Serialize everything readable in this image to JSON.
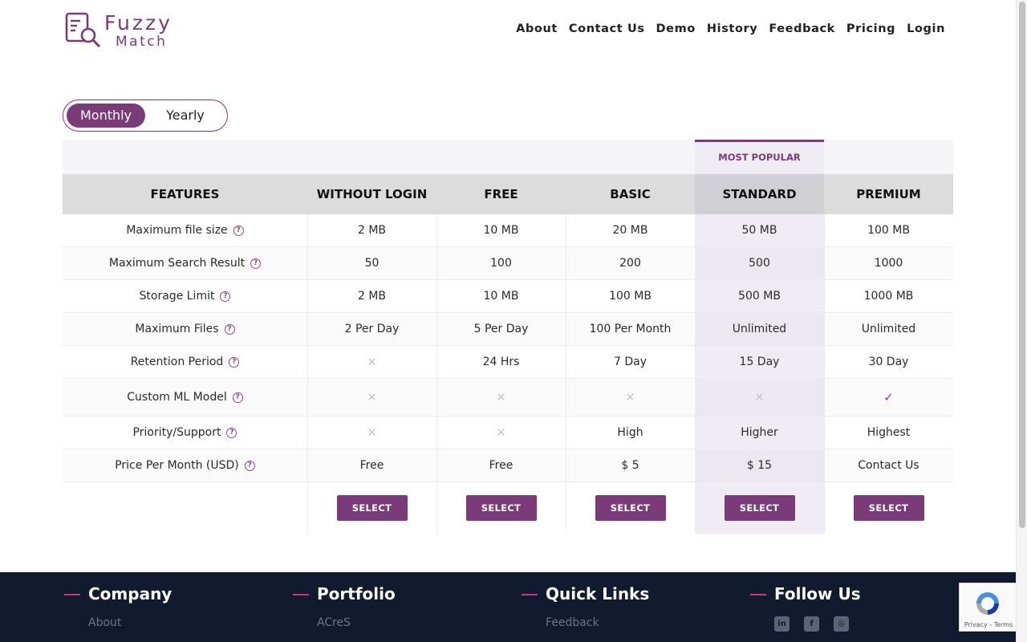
{
  "header": {
    "logo": {
      "word1": "Fuzzy",
      "word2": "Match"
    },
    "nav": [
      "About",
      "Contact Us",
      "Demo",
      "History",
      "Feedback",
      "Pricing",
      "Login"
    ]
  },
  "billing_toggle": {
    "active": "Monthly",
    "inactive": "Yearly"
  },
  "table": {
    "badge": "MOST POPULAR",
    "highlight_plan": "STANDARD",
    "columns": [
      "FEATURES",
      "WITHOUT LOGIN",
      "FREE",
      "BASIC",
      "STANDARD",
      "PREMIUM"
    ],
    "rows": [
      {
        "feature": "Maximum file size",
        "values": [
          "2 MB",
          "10 MB",
          "20 MB",
          "50 MB",
          "100 MB"
        ]
      },
      {
        "feature": "Maximum Search Result",
        "values": [
          "50",
          "100",
          "200",
          "500",
          "1000"
        ]
      },
      {
        "feature": "Storage Limit",
        "values": [
          "2 MB",
          "10 MB",
          "100 MB",
          "500 MB",
          "1000 MB"
        ]
      },
      {
        "feature": "Maximum Files",
        "values": [
          "2 Per Day",
          "5 Per Day",
          "100 Per Month",
          "Unlimited",
          "Unlimited"
        ]
      },
      {
        "feature": "Retention Period",
        "values": [
          "×",
          "24 Hrs",
          "7 Day",
          "15 Day",
          "30 Day"
        ]
      },
      {
        "feature": "Custom ML Model",
        "values": [
          "×",
          "×",
          "×",
          "×",
          "✓"
        ]
      },
      {
        "feature": "Priority/Support",
        "values": [
          "×",
          "×",
          "High",
          "Higher",
          "Highest"
        ]
      },
      {
        "feature": "Price Per Month (USD)",
        "values": [
          "Free",
          "Free",
          "$ 5",
          "$ 15",
          "Contact Us"
        ]
      }
    ],
    "select_label": "SELECT"
  },
  "footer": {
    "columns": [
      {
        "title": "Company",
        "link": "About"
      },
      {
        "title": "Portfolio",
        "link": "ACreS"
      },
      {
        "title": "Quick Links",
        "link": "Feedback"
      },
      {
        "title": "Follow Us",
        "social": [
          "linkedin-icon",
          "facebook-icon",
          "instagram-icon"
        ]
      }
    ]
  },
  "recaptcha": {
    "text": "Privacy - Terms"
  },
  "colors": {
    "brand": "#7b3b78",
    "footer_bg": "#111a2e",
    "accent_dash": "#c63c7a"
  }
}
